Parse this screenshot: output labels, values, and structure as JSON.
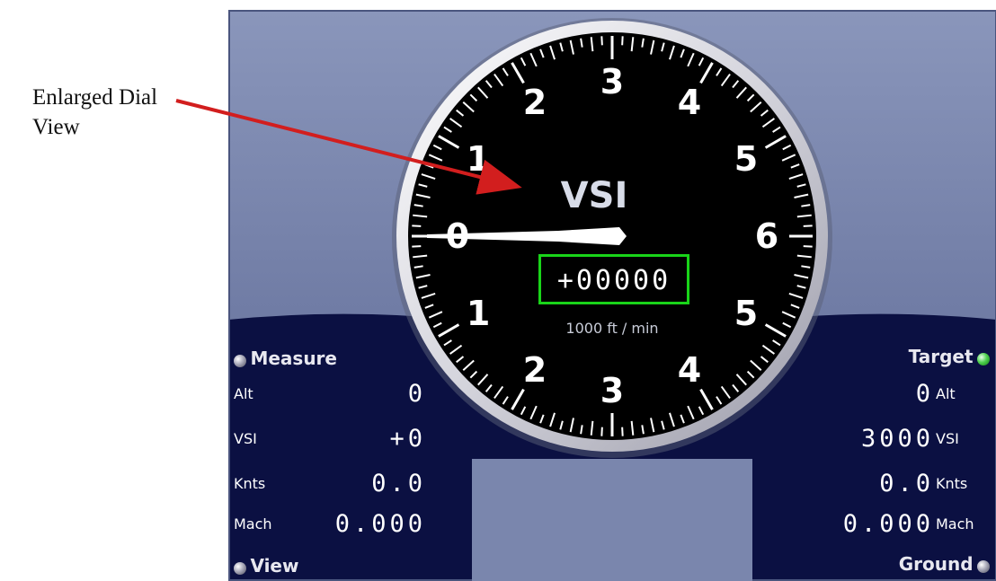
{
  "annotation": {
    "line1": "Enlarged Dial",
    "line2": "View"
  },
  "dial": {
    "title": "VSI",
    "readout": "+00000",
    "unit": "1000 ft / min",
    "labels_upper": [
      "0",
      "1",
      "2",
      "3",
      "4",
      "5",
      "6"
    ],
    "labels_lower": [
      "1",
      "2",
      "3",
      "4",
      "5"
    ],
    "needle_value": 0
  },
  "left_panel": {
    "header": "Measure",
    "footer": "View",
    "rows": [
      {
        "label": "Alt",
        "value": "0"
      },
      {
        "label": "VSI",
        "value": "+0"
      },
      {
        "label": "Knts",
        "value": "0.0"
      },
      {
        "label": "Mach",
        "value": "0.000"
      }
    ]
  },
  "right_panel": {
    "header": "Target",
    "footer": "Ground",
    "rows": [
      {
        "label": "Alt",
        "value": "0"
      },
      {
        "label": "VSI",
        "value": "3000"
      },
      {
        "label": "Knts",
        "value": "0.0"
      },
      {
        "label": "Mach",
        "value": "0.000"
      }
    ]
  },
  "colors": {
    "panel_bg": "#0b1042",
    "upper_bg": "#7a86ad",
    "readout_border": "#19d419",
    "led_green": "#4fd24f",
    "arrow": "#d21e1e"
  }
}
